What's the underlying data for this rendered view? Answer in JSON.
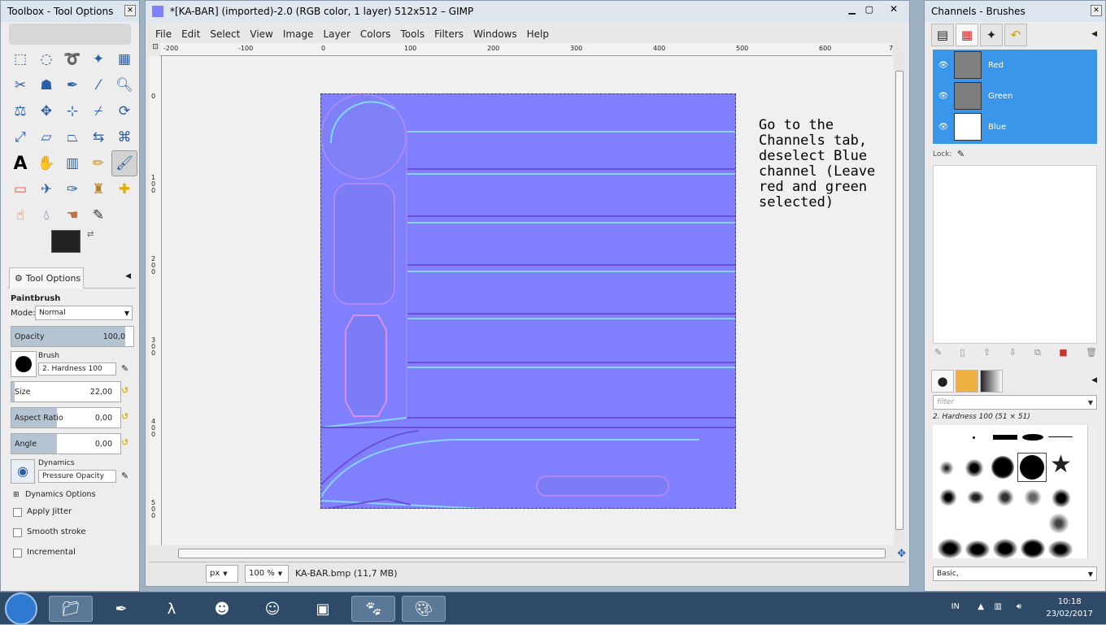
{
  "toolbox": {
    "title": "Toolbox - Tool Options",
    "tools": [
      "rect-select",
      "ellipse-select",
      "free-select",
      "fuzzy-select",
      "by-color-select",
      "scissors",
      "foreground-select",
      "paths",
      "color-picker",
      "zoom",
      "measure",
      "move",
      "align",
      "crop",
      "rotate",
      "scale",
      "shear",
      "perspective",
      "flip",
      "cage",
      "text",
      "heal",
      "blend",
      "pencil",
      "paintbrush",
      "eraser",
      "airbrush",
      "ink",
      "clone",
      "perspective-clone",
      "smudge",
      "dodge",
      "blur",
      "convolve",
      "dodge-burn"
    ],
    "tab_label": "Tool Options",
    "tool_name": "Paintbrush",
    "mode_label": "Mode:",
    "mode_value": "Normal",
    "opacity_label": "Opacity",
    "opacity_value": "100,0",
    "brush_label": "Brush",
    "brush_value": "2. Hardness 100",
    "size_label": "Size",
    "size_value": "22,00",
    "aspect_label": "Aspect Ratio",
    "aspect_value": "0,00",
    "angle_label": "Angle",
    "angle_value": "0,00",
    "dynamics_label": "Dynamics",
    "dynamics_value": "Pressure Opacity",
    "dynamics_options": "Dynamics Options",
    "apply_jitter": "Apply Jitter",
    "smooth_stroke": "Smooth stroke",
    "incremental": "Incremental"
  },
  "gimp": {
    "title": "*[KA-BAR] (imported)-2.0 (RGB color, 1 layer) 512x512 – GIMP",
    "menus": [
      "File",
      "Edit",
      "Select",
      "View",
      "Image",
      "Layer",
      "Colors",
      "Tools",
      "Filters",
      "Windows",
      "Help"
    ],
    "ruler_h": [
      "-200",
      "-100",
      "0",
      "100",
      "200",
      "300",
      "400",
      "500",
      "600",
      "7"
    ],
    "ruler_v": [
      "0",
      "100",
      "200",
      "300",
      "400",
      "500"
    ],
    "note": "Go to the Channels tab, deselect Blue channel (Leave red and green selected)",
    "unit": "px",
    "zoom": "100 %",
    "status_file": "KA-BAR.bmp (11,7 MB)"
  },
  "dock": {
    "title": "Channels - Brushes",
    "channels": [
      {
        "name": "Red",
        "thumb": "#808080"
      },
      {
        "name": "Green",
        "thumb": "#7d7d7d"
      },
      {
        "name": "Blue",
        "thumb": "#ffffff"
      }
    ],
    "lock_label": "Lock:",
    "filter_placeholder": "filter",
    "brush_info": "2. Hardness 100 (51 × 51)",
    "brush_set": "Basic,"
  },
  "taskbar": {
    "lang": "IN",
    "time": "10:18",
    "date": "23/02/2017"
  },
  "colors": {
    "normal_map": "#8080ff",
    "selection_blue": "#3a96e8"
  }
}
